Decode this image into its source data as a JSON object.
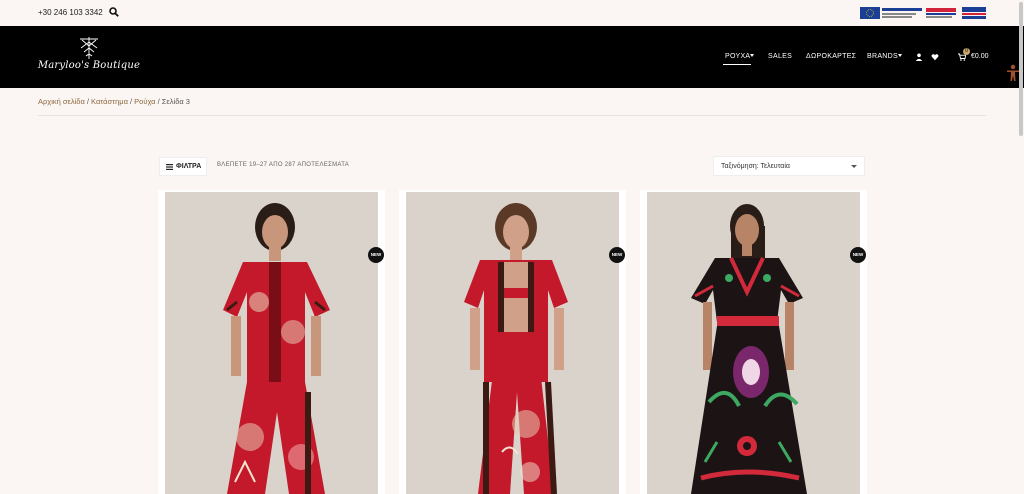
{
  "topbar": {
    "phone": "+30 246 103 3342",
    "search_icon": "search-icon",
    "eu_logos": "eu-funding-logos"
  },
  "header": {
    "logo_text": "Maryloo's Boutique",
    "nav": [
      {
        "label": "ΡΟΥΧΑ",
        "active": true,
        "dropdown": true
      },
      {
        "label": "SALES",
        "active": false,
        "dropdown": false
      },
      {
        "label": "ΔΩΡΟΚΑΡΤΕΣ",
        "active": false,
        "dropdown": false
      },
      {
        "label": "BRANDS",
        "active": false,
        "dropdown": true
      }
    ],
    "icons": [
      "user-icon",
      "heart-icon",
      "cart-icon"
    ],
    "cart_count": "0",
    "cart_total": "€0.00"
  },
  "breadcrumb": {
    "items": [
      "Αρχική σελίδα",
      "Κατάστημα",
      "Ρούχα",
      "Σελίδα 3"
    ]
  },
  "toolbar": {
    "filter_label": "ΦΙΛΤΡΑ",
    "results_text": "ΒΛΕΠΕΤΕ 19–27 ΑΠΟ 287 ΑΠΟΤΕΛΕΣΜΑΤΑ",
    "sort_label": "Ταξινόμηση: Τελευταία"
  },
  "products": [
    {
      "badge": "NEW"
    },
    {
      "badge": "NEW"
    },
    {
      "badge": "NEW"
    }
  ],
  "colors": {
    "page_bg": "#fbf5f3",
    "header_bg": "#000000",
    "accent": "#8b6a3f",
    "garment_red": "#c4182b"
  }
}
